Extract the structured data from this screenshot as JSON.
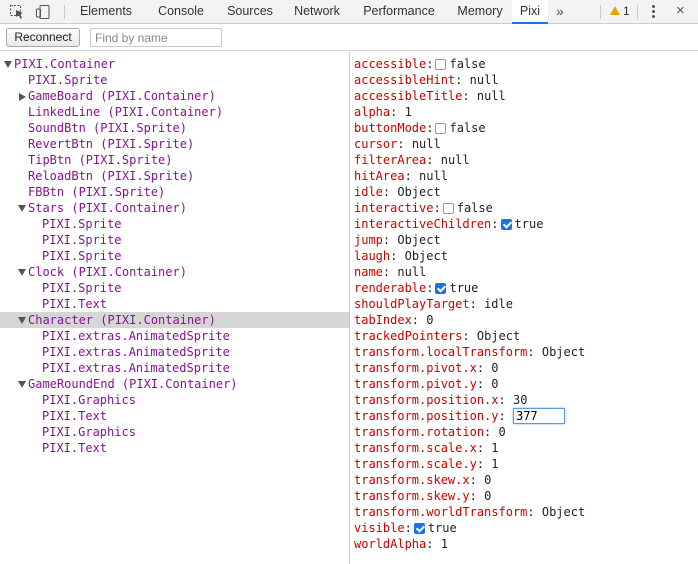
{
  "devtools": {
    "tabs": [
      "Elements",
      "Console",
      "Sources",
      "Network",
      "Performance",
      "Memory",
      "Pixi"
    ],
    "active_tab": "Pixi",
    "more_tabs_glyph": "»",
    "warning_count": "1",
    "close_glyph": "×"
  },
  "toolbar": {
    "reconnect_label": "Reconnect",
    "search_placeholder": "Find by name"
  },
  "tree": [
    {
      "label": "PIXI.Container",
      "depth": 0,
      "arrow": "down"
    },
    {
      "label": "PIXI.Sprite",
      "depth": 1,
      "arrow": "none"
    },
    {
      "label": "GameBoard (PIXI.Container)",
      "depth": 1,
      "arrow": "right"
    },
    {
      "label": "LinkedLine (PIXI.Container)",
      "depth": 1,
      "arrow": "none"
    },
    {
      "label": "SoundBtn (PIXI.Sprite)",
      "depth": 1,
      "arrow": "none"
    },
    {
      "label": "RevertBtn (PIXI.Sprite)",
      "depth": 1,
      "arrow": "none"
    },
    {
      "label": "TipBtn (PIXI.Sprite)",
      "depth": 1,
      "arrow": "none"
    },
    {
      "label": "ReloadBtn (PIXI.Sprite)",
      "depth": 1,
      "arrow": "none"
    },
    {
      "label": "FBBtn (PIXI.Sprite)",
      "depth": 1,
      "arrow": "none"
    },
    {
      "label": "Stars (PIXI.Container)",
      "depth": 1,
      "arrow": "down"
    },
    {
      "label": "PIXI.Sprite",
      "depth": 2,
      "arrow": "none"
    },
    {
      "label": "PIXI.Sprite",
      "depth": 2,
      "arrow": "none"
    },
    {
      "label": "PIXI.Sprite",
      "depth": 2,
      "arrow": "none"
    },
    {
      "label": "Clock (PIXI.Container)",
      "depth": 1,
      "arrow": "down"
    },
    {
      "label": "PIXI.Sprite",
      "depth": 2,
      "arrow": "none"
    },
    {
      "label": "PIXI.Text",
      "depth": 2,
      "arrow": "none"
    },
    {
      "label": "Character (PIXI.Container)",
      "depth": 1,
      "arrow": "down",
      "selected": true
    },
    {
      "label": "PIXI.extras.AnimatedSprite",
      "depth": 2,
      "arrow": "none"
    },
    {
      "label": "PIXI.extras.AnimatedSprite",
      "depth": 2,
      "arrow": "none"
    },
    {
      "label": "PIXI.extras.AnimatedSprite",
      "depth": 2,
      "arrow": "none"
    },
    {
      "label": "GameRoundEnd (PIXI.Container)",
      "depth": 1,
      "arrow": "down"
    },
    {
      "label": "PIXI.Graphics",
      "depth": 2,
      "arrow": "none"
    },
    {
      "label": "PIXI.Text",
      "depth": 2,
      "arrow": "none"
    },
    {
      "label": "PIXI.Graphics",
      "depth": 2,
      "arrow": "none"
    },
    {
      "label": "PIXI.Text",
      "depth": 2,
      "arrow": "none"
    }
  ],
  "properties": [
    {
      "key": "accessible",
      "value": "false",
      "checkbox": "off"
    },
    {
      "key": "accessibleHint",
      "value": "null"
    },
    {
      "key": "accessibleTitle",
      "value": "null"
    },
    {
      "key": "alpha",
      "value": "1"
    },
    {
      "key": "buttonMode",
      "value": "false",
      "checkbox": "off"
    },
    {
      "key": "cursor",
      "value": "null"
    },
    {
      "key": "filterArea",
      "value": "null"
    },
    {
      "key": "hitArea",
      "value": "null"
    },
    {
      "key": "idle",
      "value": "Object"
    },
    {
      "key": "interactive",
      "value": "false",
      "checkbox": "off"
    },
    {
      "key": "interactiveChildren",
      "value": "true",
      "checkbox": "on"
    },
    {
      "key": "jump",
      "value": "Object"
    },
    {
      "key": "laugh",
      "value": "Object"
    },
    {
      "key": "name",
      "value": "null"
    },
    {
      "key": "renderable",
      "value": "true",
      "checkbox": "on"
    },
    {
      "key": "shouldPlayTarget",
      "value": "idle"
    },
    {
      "key": "tabIndex",
      "value": "0"
    },
    {
      "key": "trackedPointers",
      "value": "Object"
    },
    {
      "key": "transform.localTransform",
      "value": "Object"
    },
    {
      "key": "transform.pivot.x",
      "value": "0"
    },
    {
      "key": "transform.pivot.y",
      "value": "0"
    },
    {
      "key": "transform.position.x",
      "value": "30"
    },
    {
      "key": "transform.position.y",
      "value": "377",
      "editing": true
    },
    {
      "key": "transform.rotation",
      "value": "0"
    },
    {
      "key": "transform.scale.x",
      "value": "1"
    },
    {
      "key": "transform.scale.y",
      "value": "1"
    },
    {
      "key": "transform.skew.x",
      "value": "0"
    },
    {
      "key": "transform.skew.y",
      "value": "0"
    },
    {
      "key": "transform.worldTransform",
      "value": "Object"
    },
    {
      "key": "visible",
      "value": "true",
      "checkbox": "on"
    },
    {
      "key": "worldAlpha",
      "value": "1"
    }
  ]
}
